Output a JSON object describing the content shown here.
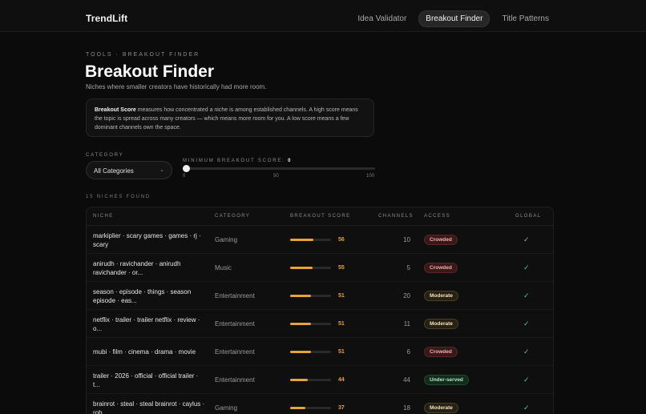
{
  "brand": "TrendLift",
  "nav": [
    {
      "label": "Idea Validator",
      "active": false
    },
    {
      "label": "Breakout Finder",
      "active": true
    },
    {
      "label": "Title Patterns",
      "active": false
    }
  ],
  "header": {
    "eyebrow": "TOOLS · BREAKOUT FINDER",
    "title": "Breakout Finder",
    "subtitle": "Niches where smaller creators have historically had more room."
  },
  "info": {
    "term": "Breakout Score",
    "text": " measures how concentrated a niche is among established channels. A high score means the topic is spread across many creators — which means more room for you. A low score means a few dominant channels own the space."
  },
  "filters": {
    "category_label": "CATEGORY",
    "category_value": "All Categories",
    "score_label": "MINIMUM BREAKOUT SCORE:",
    "score_value": 0,
    "ticks": [
      "0",
      "50",
      "100"
    ]
  },
  "results": {
    "count_label": "15 NICHES FOUND"
  },
  "table": {
    "columns": [
      "NICHE",
      "CATEGORY",
      "BREAKOUT SCORE",
      "CHANNELS",
      "ACCESS",
      "GLOBAL"
    ],
    "rows": [
      {
        "niche": "markiplier · scary games · games · rj · scary",
        "category": "Gaming",
        "score": 56,
        "channels": 10,
        "access": "Crowded",
        "access_type": "crowded",
        "global": "✓"
      },
      {
        "niche": "anirudh · ravichander · anirudh ravichander · or...",
        "category": "Music",
        "score": 55,
        "channels": 5,
        "access": "Crowded",
        "access_type": "crowded",
        "global": "✓"
      },
      {
        "niche": "season · episode · things · season episode · eas...",
        "category": "Entertainment",
        "score": 51,
        "channels": 20,
        "access": "Moderate",
        "access_type": "moderate",
        "global": "✓"
      },
      {
        "niche": "netflix · trailer · trailer netflix · review · o...",
        "category": "Entertainment",
        "score": 51,
        "channels": 11,
        "access": "Moderate",
        "access_type": "moderate",
        "global": "✓"
      },
      {
        "niche": "mubi · film · cinema · drama · movie",
        "category": "Entertainment",
        "score": 51,
        "channels": 6,
        "access": "Crowded",
        "access_type": "crowded",
        "global": "✓"
      },
      {
        "niche": "trailer · 2026 · official · official trailer · t...",
        "category": "Entertainment",
        "score": 44,
        "channels": 44,
        "access": "Under-served",
        "access_type": "underserved",
        "global": "✓"
      },
      {
        "niche": "brainrot · steal · steal brainrot · caylus · rob...",
        "category": "Gaming",
        "score": 37,
        "channels": 18,
        "access": "Moderate",
        "access_type": "moderate",
        "global": "✓"
      }
    ]
  }
}
